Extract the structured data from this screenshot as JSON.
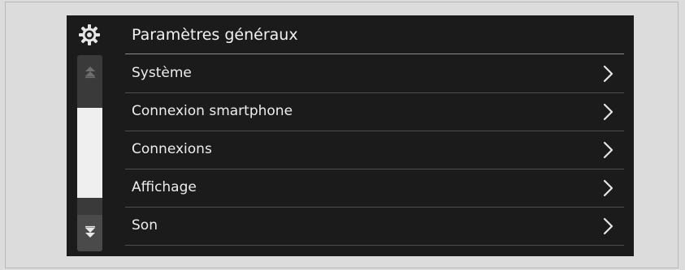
{
  "header": {
    "icon": "gear-icon",
    "title": "Paramètres généraux"
  },
  "scrollbar": {
    "up_icon": "scroll-up-icon",
    "down_icon": "scroll-down-icon",
    "thumb_start_fraction": 0.27,
    "thumb_size_fraction": 0.46
  },
  "menu": {
    "chevron_icon": "chevron-right-icon",
    "items": [
      {
        "label": "Système"
      },
      {
        "label": "Connexion smartphone"
      },
      {
        "label": "Connexions"
      },
      {
        "label": "Affichage"
      },
      {
        "label": "Son"
      }
    ]
  },
  "colors": {
    "screen_background": "#1b1b1b",
    "text": "#ededed",
    "divider": "#4e4e4e"
  }
}
